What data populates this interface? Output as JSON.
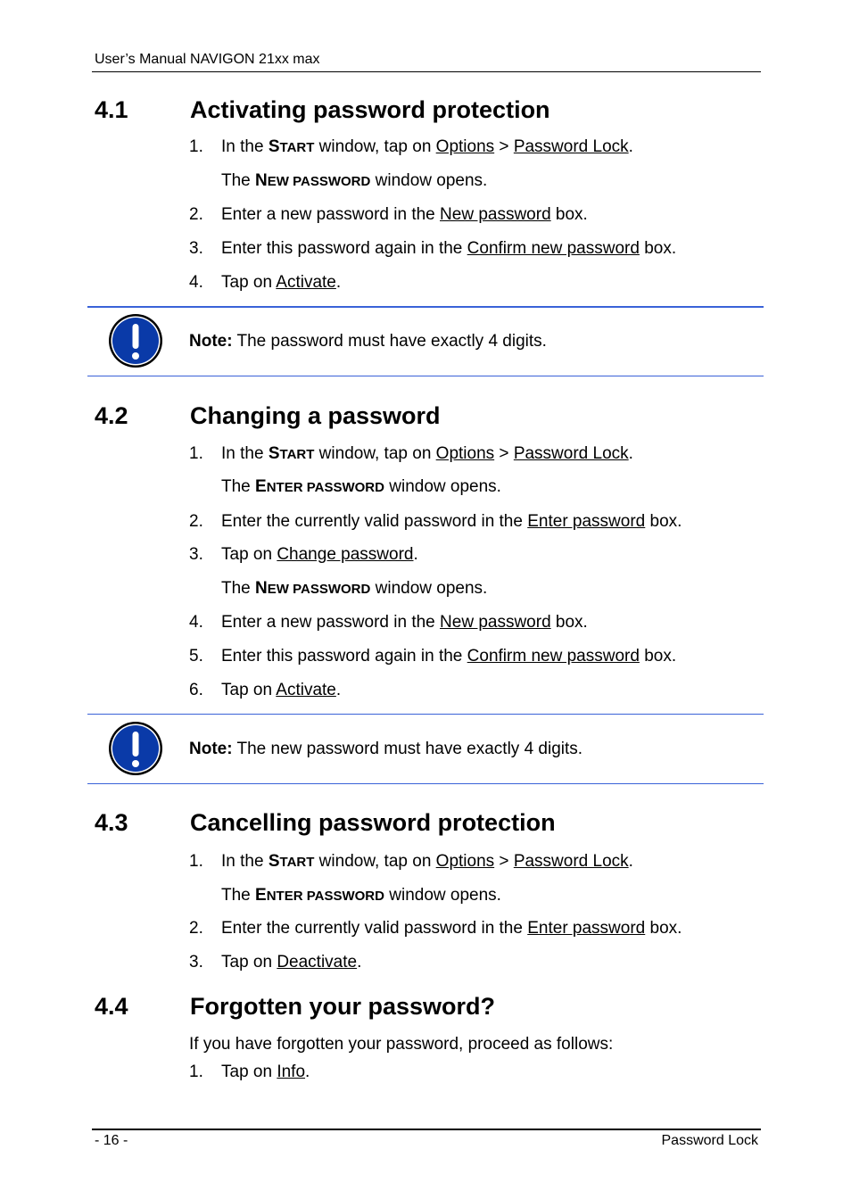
{
  "header": {
    "title": "User’s Manual NAVIGON 21xx max"
  },
  "footer": {
    "page": "- 16 -",
    "chapter": "Password Lock"
  },
  "sections": [
    {
      "number": "4.1",
      "title": "Activating password protection",
      "steps": [
        {
          "num": "1.",
          "pre": "In the ",
          "sc_first": "S",
          "sc_rest": "TART",
          "mid": " window, tap on ",
          "link1": "Options",
          "sep": " > ",
          "link2": "Password Lock",
          "post": "."
        },
        {
          "result_pre": "The ",
          "sc1_first": "N",
          "sc1_rest": "EW",
          "sc2": " PASSWORD",
          "result_post": " window opens."
        },
        {
          "num": "2.",
          "pre": "Enter a new password in the ",
          "link": "New password",
          "post": " box."
        },
        {
          "num": "3.",
          "pre": "Enter this password again in the ",
          "link": "Confirm new password",
          "post": " box."
        },
        {
          "num": "4.",
          "pre": "Tap on ",
          "link": "Activate",
          "post": "."
        }
      ],
      "note": {
        "label": "Note:",
        "text": " The password must have exactly 4 digits."
      }
    },
    {
      "number": "4.2",
      "title": "Changing a password",
      "steps": [
        {
          "num": "1.",
          "pre": "In the ",
          "sc_first": "S",
          "sc_rest": "TART",
          "mid": " window, tap on ",
          "link1": "Options",
          "sep": " > ",
          "link2": "Password Lock",
          "post": "."
        },
        {
          "result_pre": "The ",
          "sc1_first": "E",
          "sc1_rest": "NTER",
          "sc2": " PASSWORD",
          "result_post": " window opens."
        },
        {
          "num": "2.",
          "pre": "Enter the currently valid password in the ",
          "link": "Enter password",
          "post": " box."
        },
        {
          "num": "3.",
          "pre": "Tap on ",
          "link": "Change password",
          "post": "."
        },
        {
          "result_pre": "The ",
          "sc1_first": "N",
          "sc1_rest": "EW",
          "sc2": " PASSWORD",
          "result_post": " window opens."
        },
        {
          "num": "4.",
          "pre": "Enter a new password in the ",
          "link": "New password",
          "post": " box."
        },
        {
          "num": "5.",
          "pre": "Enter this password again in the ",
          "link": "Confirm new password",
          "post": " box."
        },
        {
          "num": "6.",
          "pre": "Tap on ",
          "link": "Activate",
          "post": "."
        }
      ],
      "note": {
        "label": "Note:",
        "text": " The new password must have exactly 4 digits."
      }
    },
    {
      "number": "4.3",
      "title": "Cancelling password protection",
      "steps": [
        {
          "num": "1.",
          "pre": "In the ",
          "sc_first": "S",
          "sc_rest": "TART",
          "mid": " window, tap on ",
          "link1": "Options",
          "sep": " > ",
          "link2": "Password Lock",
          "post": "."
        },
        {
          "result_pre": "The ",
          "sc1_first": "E",
          "sc1_rest": "NTER",
          "sc2": " PASSWORD",
          "result_post": " window opens."
        },
        {
          "num": "2.",
          "pre": "Enter the currently valid password in the ",
          "link": "Enter password",
          "post": " box."
        },
        {
          "num": "3.",
          "pre": "Tap on ",
          "link": "Deactivate",
          "post": "."
        }
      ]
    },
    {
      "number": "4.4",
      "title": "Forgotten your password?",
      "intro": "If you have forgotten your password, proceed as follows:",
      "steps": [
        {
          "num": "1.",
          "pre": "Tap on ",
          "link": "Info",
          "post": "."
        }
      ]
    }
  ],
  "colors": {
    "note_rule": "#3a62d8",
    "note_icon_fill": "#0a3aa8"
  }
}
